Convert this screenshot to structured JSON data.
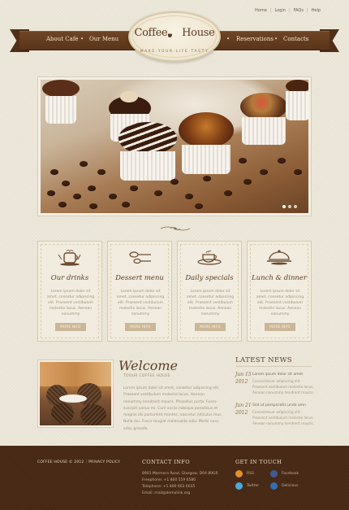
{
  "top_links": [
    "Home",
    "Login",
    "FAQs",
    "Help"
  ],
  "nav": {
    "left": [
      "About Cafe",
      "Our Menu"
    ],
    "right": [
      "Reservations",
      "Contacts"
    ]
  },
  "logo": {
    "name_part1": "Coffee",
    "name_part2": "House",
    "tagline": "MAKE·YOUR·LIFE·TASTY"
  },
  "slider": {
    "dots": 3,
    "active": 1
  },
  "features": [
    {
      "title": "Our drinks",
      "icon": "drinks-icon",
      "text": "Lorem ipsum dolor sit amet, consetur adipiscing elit. Praesent vestibulum molestie lacus. Aenean nonummy",
      "button": "MORE INFO"
    },
    {
      "title": "Dessert menu",
      "icon": "dessert-icon",
      "text": "Lorem ipsum dolor sit amet, consetur adipiscing elit. Praesent vestibulum molestie lacus. Aenean nonummy",
      "button": "MORE INFO"
    },
    {
      "title": "Daily specials",
      "icon": "coffee-cup-icon",
      "text": "Lorem ipsum dolor sit amet, consetur adipiscing elit. Praesent vestibulum molestie lacus. Aenean nonummy",
      "button": "MORE INFO"
    },
    {
      "title": "Lunch & dinner",
      "icon": "lunch-icon",
      "text": "Lorem ipsum dolor sit amet, consetur adipiscing elit. Praesent vestibulum molestie lacus. Aenean nonummy",
      "button": "MORE INFO"
    }
  ],
  "welcome": {
    "title": "Welcome",
    "subtitle": "TOOUR COFFEE HOUSE",
    "text": "Lorem ipsum dolor sit amet, consetur adipiscing elit. Praesent vestibulum molestie lacus. Aenean nonummy hendrerit mauris. Phasellus porta. Fusce suscipit varius mi. Cum sociis natoque penatibus et magnis dis parturient montes, nascetur ridiculus mus. Nulla dui. Fusce feugiat malesuada odio. Morbi nunc odio, gravida"
  },
  "news": {
    "title": "LATEST NEWS",
    "items": [
      {
        "month": "Jun 15",
        "year": "2012",
        "headline": "Lorem ipsum dolor sit amet",
        "text": "Consectetuer adipiscing elit. Praesent vestibulum molestie lacus. Aenean nonummy hendrerit mauris."
      },
      {
        "month": "Jun 21",
        "year": "2012",
        "headline": "Sed ut perspiciatis unde omn",
        "text": "Consectetuer adipiscing elit. Praesent vestibulum molestie lacus. Aenean nonummy hendrerit mauris."
      }
    ]
  },
  "footer": {
    "copyright": "COFFEE HOUSE © 2012",
    "privacy": "PRIVACY POLICY",
    "contact_title": "CONTACT INFO",
    "address": "8901 Marmora Road, Glasgow, D04 89GR",
    "freephone": "Freephone: +1 800 559 6580",
    "telephone": "Telephone: +1 800 603 6035",
    "email": "Email: mail@demolink.org",
    "social_title": "GET IN TOUCH",
    "social": [
      "RSS",
      "Facebook",
      "Twitter",
      "Delicious"
    ]
  },
  "colors": {
    "brown": "#5a3519",
    "footer": "#4a2b17",
    "paper": "#ebe6d8",
    "button": "#c9b797"
  }
}
